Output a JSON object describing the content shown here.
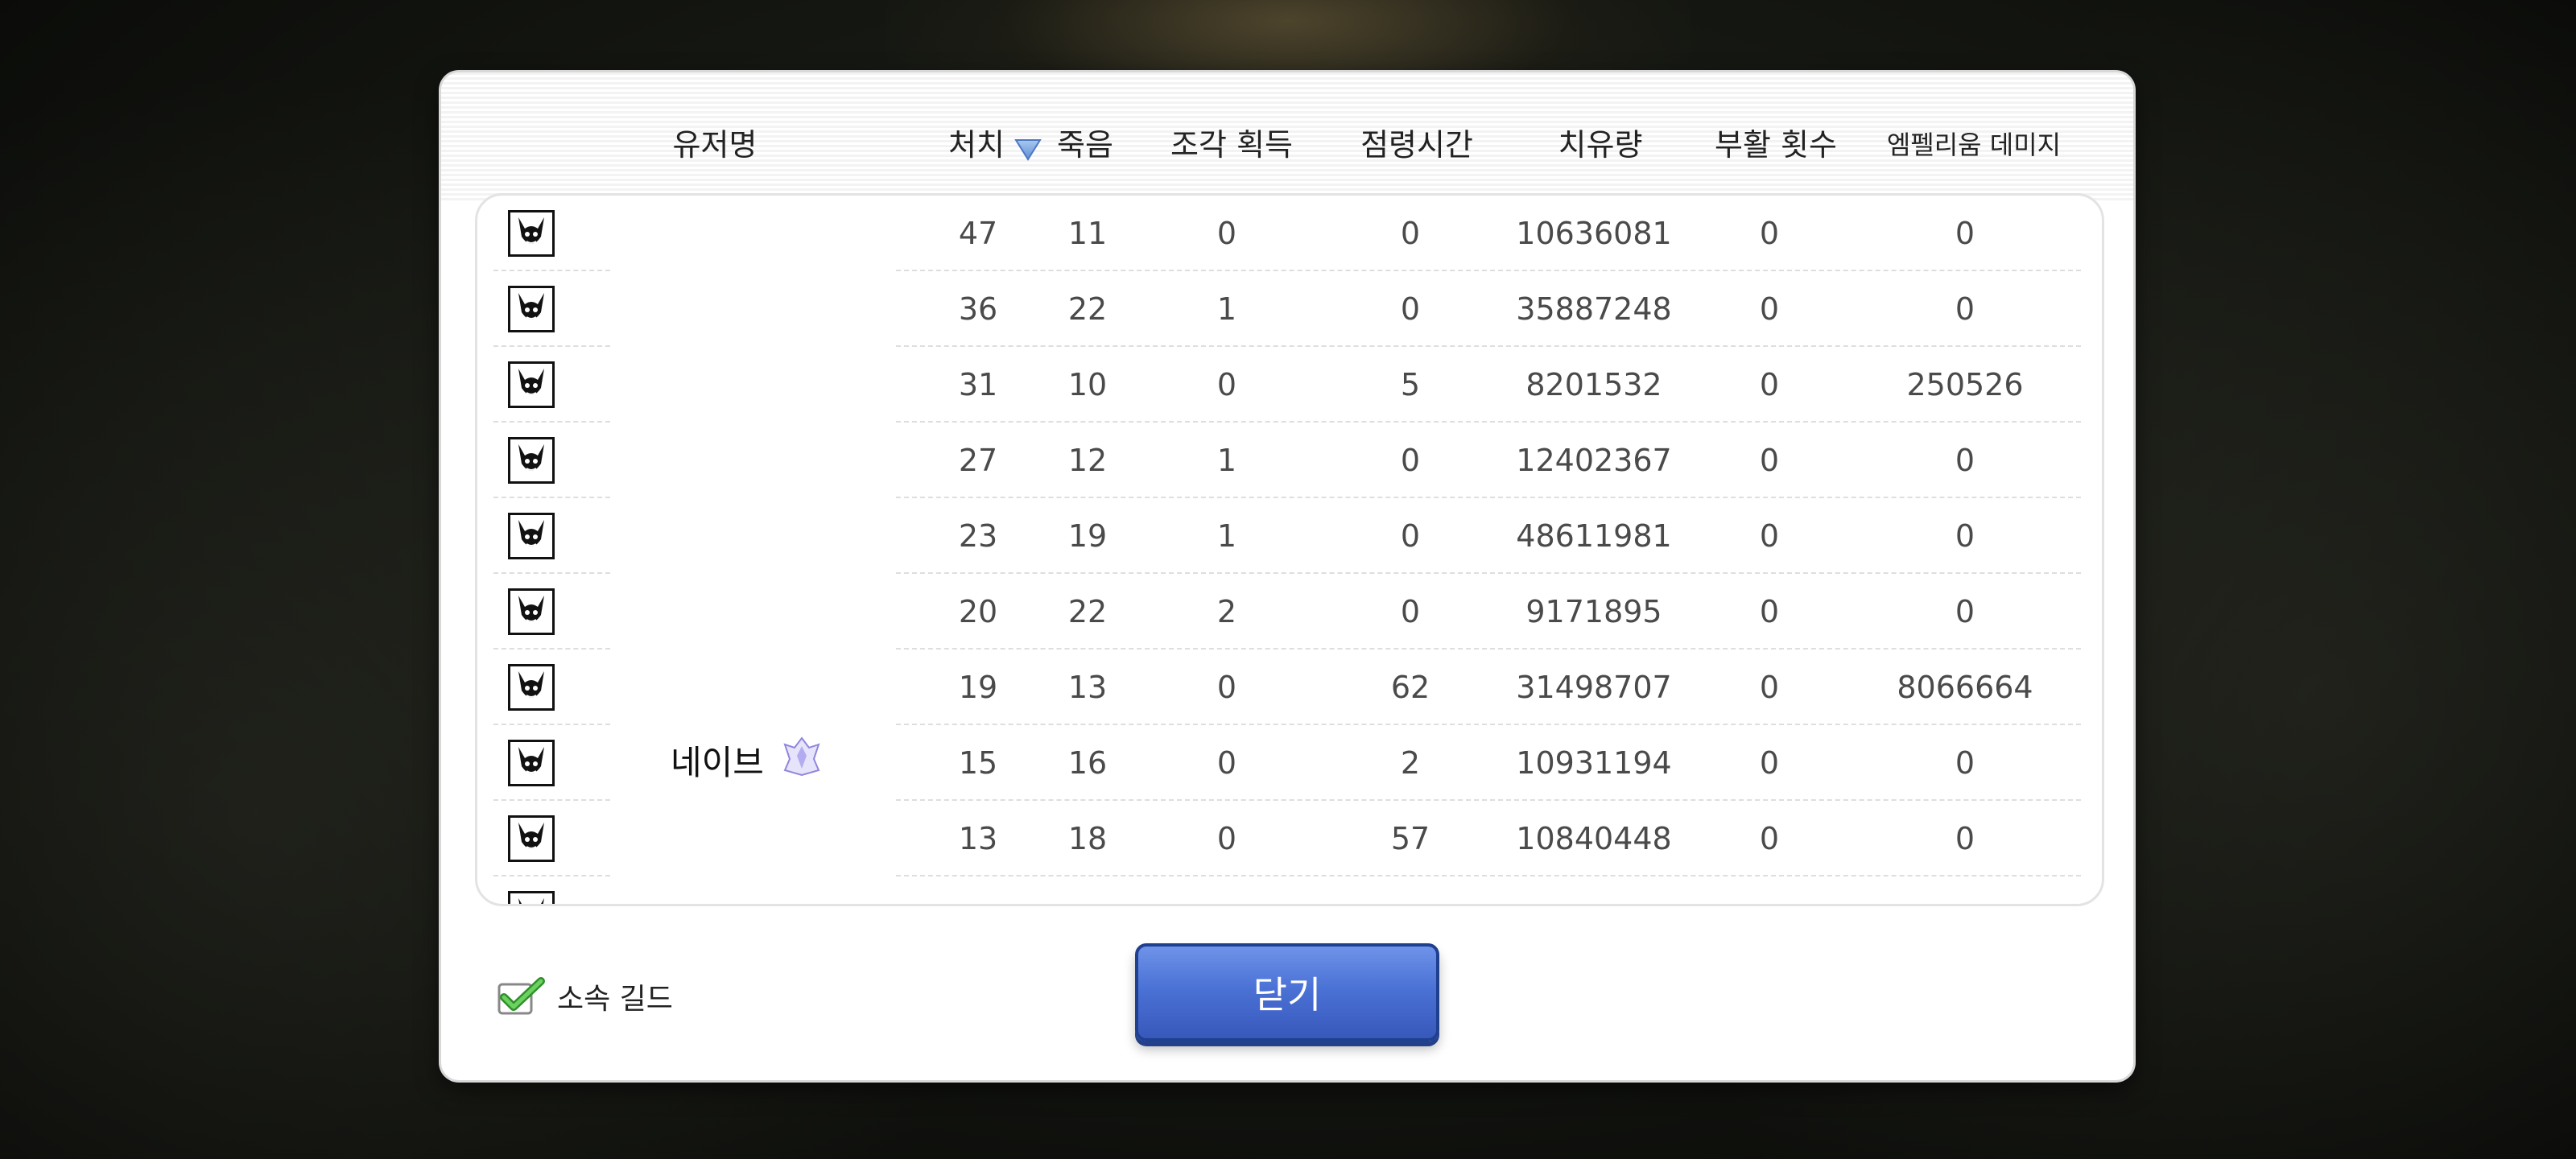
{
  "header": {
    "username": "유저명",
    "kills": "처치",
    "deaths": "죽음",
    "fragments": "조각 획득",
    "capture_time": "점령시간",
    "healing": "치유량",
    "revives": "부활 횟수",
    "emperium_damage": "엠펠리움 데미지"
  },
  "sort_icon": "sort-descending-triangle-icon",
  "rows": [
    {
      "name": "",
      "kills": "47",
      "deaths": "11",
      "fragments": "0",
      "capture_time": "0",
      "healing": "10636081",
      "revives": "0",
      "emperium_damage": "0"
    },
    {
      "name": "",
      "kills": "36",
      "deaths": "22",
      "fragments": "1",
      "capture_time": "0",
      "healing": "35887248",
      "revives": "0",
      "emperium_damage": "0"
    },
    {
      "name": "",
      "kills": "31",
      "deaths": "10",
      "fragments": "0",
      "capture_time": "5",
      "healing": "8201532",
      "revives": "0",
      "emperium_damage": "250526"
    },
    {
      "name": "",
      "kills": "27",
      "deaths": "12",
      "fragments": "1",
      "capture_time": "0",
      "healing": "12402367",
      "revives": "0",
      "emperium_damage": "0"
    },
    {
      "name": "",
      "kills": "23",
      "deaths": "19",
      "fragments": "1",
      "capture_time": "0",
      "healing": "48611981",
      "revives": "0",
      "emperium_damage": "0"
    },
    {
      "name": "",
      "kills": "20",
      "deaths": "22",
      "fragments": "2",
      "capture_time": "0",
      "healing": "9171895",
      "revives": "0",
      "emperium_damage": "0"
    },
    {
      "name": "",
      "kills": "19",
      "deaths": "13",
      "fragments": "0",
      "capture_time": "62",
      "healing": "31498707",
      "revives": "0",
      "emperium_damage": "8066664"
    },
    {
      "name": "네이브",
      "kills": "15",
      "deaths": "16",
      "fragments": "0",
      "capture_time": "2",
      "healing": "10931194",
      "revives": "0",
      "emperium_damage": "0"
    },
    {
      "name": "",
      "kills": "13",
      "deaths": "18",
      "fragments": "0",
      "capture_time": "57",
      "healing": "10840448",
      "revives": "0",
      "emperium_damage": "0"
    }
  ],
  "row_icon": "guild-emblem-horns-icon",
  "footer": {
    "guild_checkbox_label": "소속 길드",
    "guild_checkbox_checked": true,
    "close_button": "닫기"
  },
  "colors": {
    "button_blue": "#4b72d6",
    "check_green": "#3fae3a"
  }
}
